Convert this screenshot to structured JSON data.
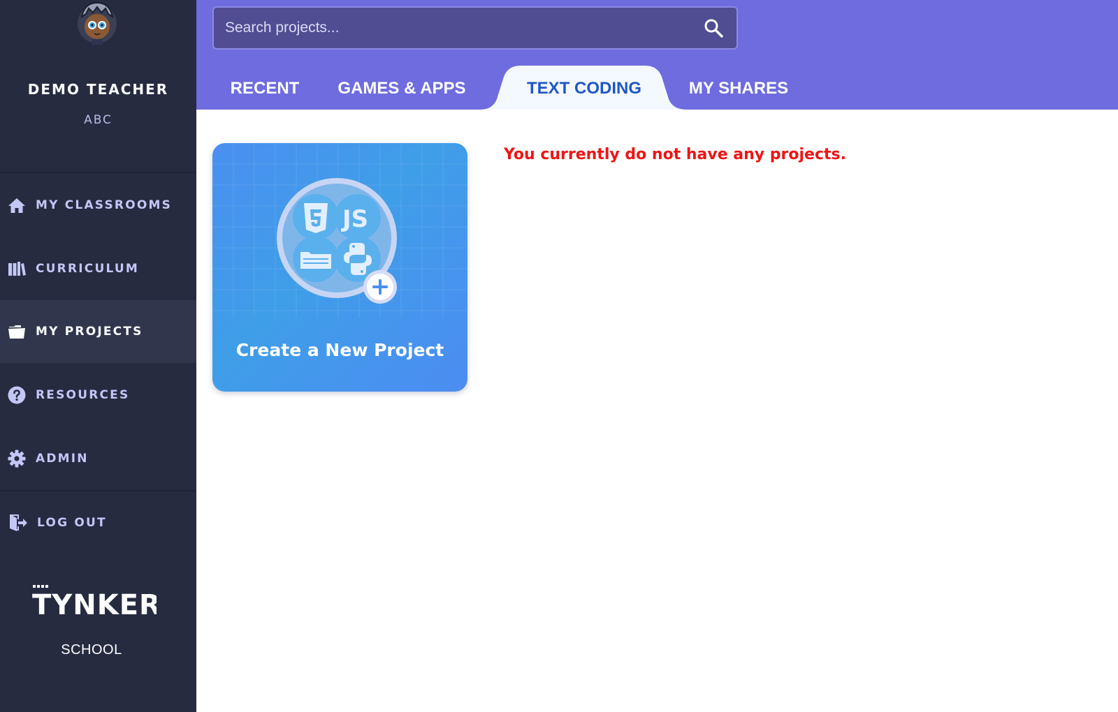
{
  "user": {
    "name": "DEMO TEACHER",
    "org": "ABC"
  },
  "sidebar": {
    "items": [
      {
        "label": "MY CLASSROOMS",
        "icon": "home-icon",
        "active": false
      },
      {
        "label": "CURRICULUM",
        "icon": "books-icon",
        "active": false
      },
      {
        "label": "MY PROJECTS",
        "icon": "folder-icon",
        "active": true
      },
      {
        "label": "RESOURCES",
        "icon": "help-circle-icon",
        "active": false
      },
      {
        "label": "ADMIN",
        "icon": "gear-icon",
        "active": false
      },
      {
        "label": "LOG OUT",
        "icon": "logout-icon",
        "active": false
      }
    ],
    "brand": "TYNKER",
    "brand_sub": "SCHOOL"
  },
  "search": {
    "placeholder": "Search projects..."
  },
  "tabs": [
    {
      "label": "RECENT",
      "active": false
    },
    {
      "label": "GAMES & APPS",
      "active": false
    },
    {
      "label": "TEXT CODING",
      "active": true
    },
    {
      "label": "MY SHARES",
      "active": false
    }
  ],
  "main": {
    "new_project_label": "Create a New Project",
    "card_badges": [
      "HTML5",
      "JS"
    ],
    "empty_message": "You currently do not have any projects."
  },
  "colors": {
    "sidebar_bg": "#262b40",
    "header_bg": "#6e6cde",
    "active_tab_text": "#1f56c6",
    "error_text": "#f01414",
    "nav_text": "#c3c7f5"
  }
}
